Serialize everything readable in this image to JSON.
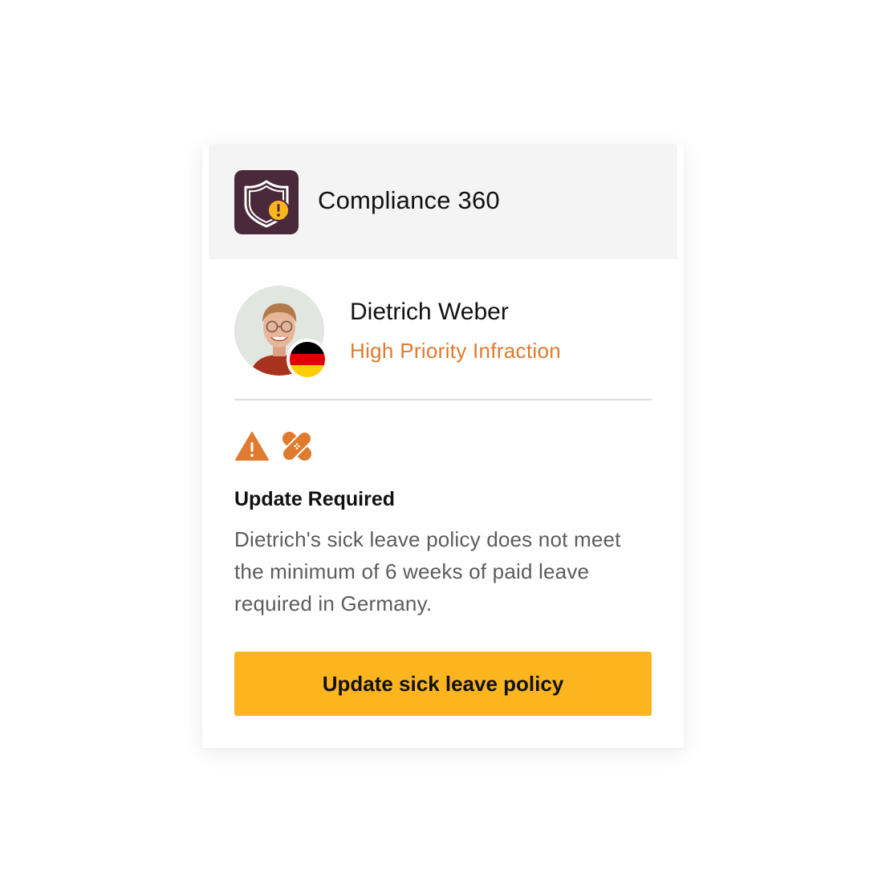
{
  "app": {
    "title": "Compliance 360",
    "icon": "shield-warning-icon",
    "icon_bg": "#4a2a3a"
  },
  "employee": {
    "name": "Dietrich Weber",
    "status": "High Priority Infraction",
    "status_color": "#e07a2e",
    "country_flag": "germany-flag-icon"
  },
  "notice": {
    "icons": [
      "warning-triangle-icon",
      "bandage-icon"
    ],
    "title": "Update Required",
    "body": "Dietrich's sick leave policy does not meet the minimum of 6 weeks of paid leave required in Germany."
  },
  "action": {
    "label": "Update sick leave policy",
    "color": "#fdb51f"
  }
}
